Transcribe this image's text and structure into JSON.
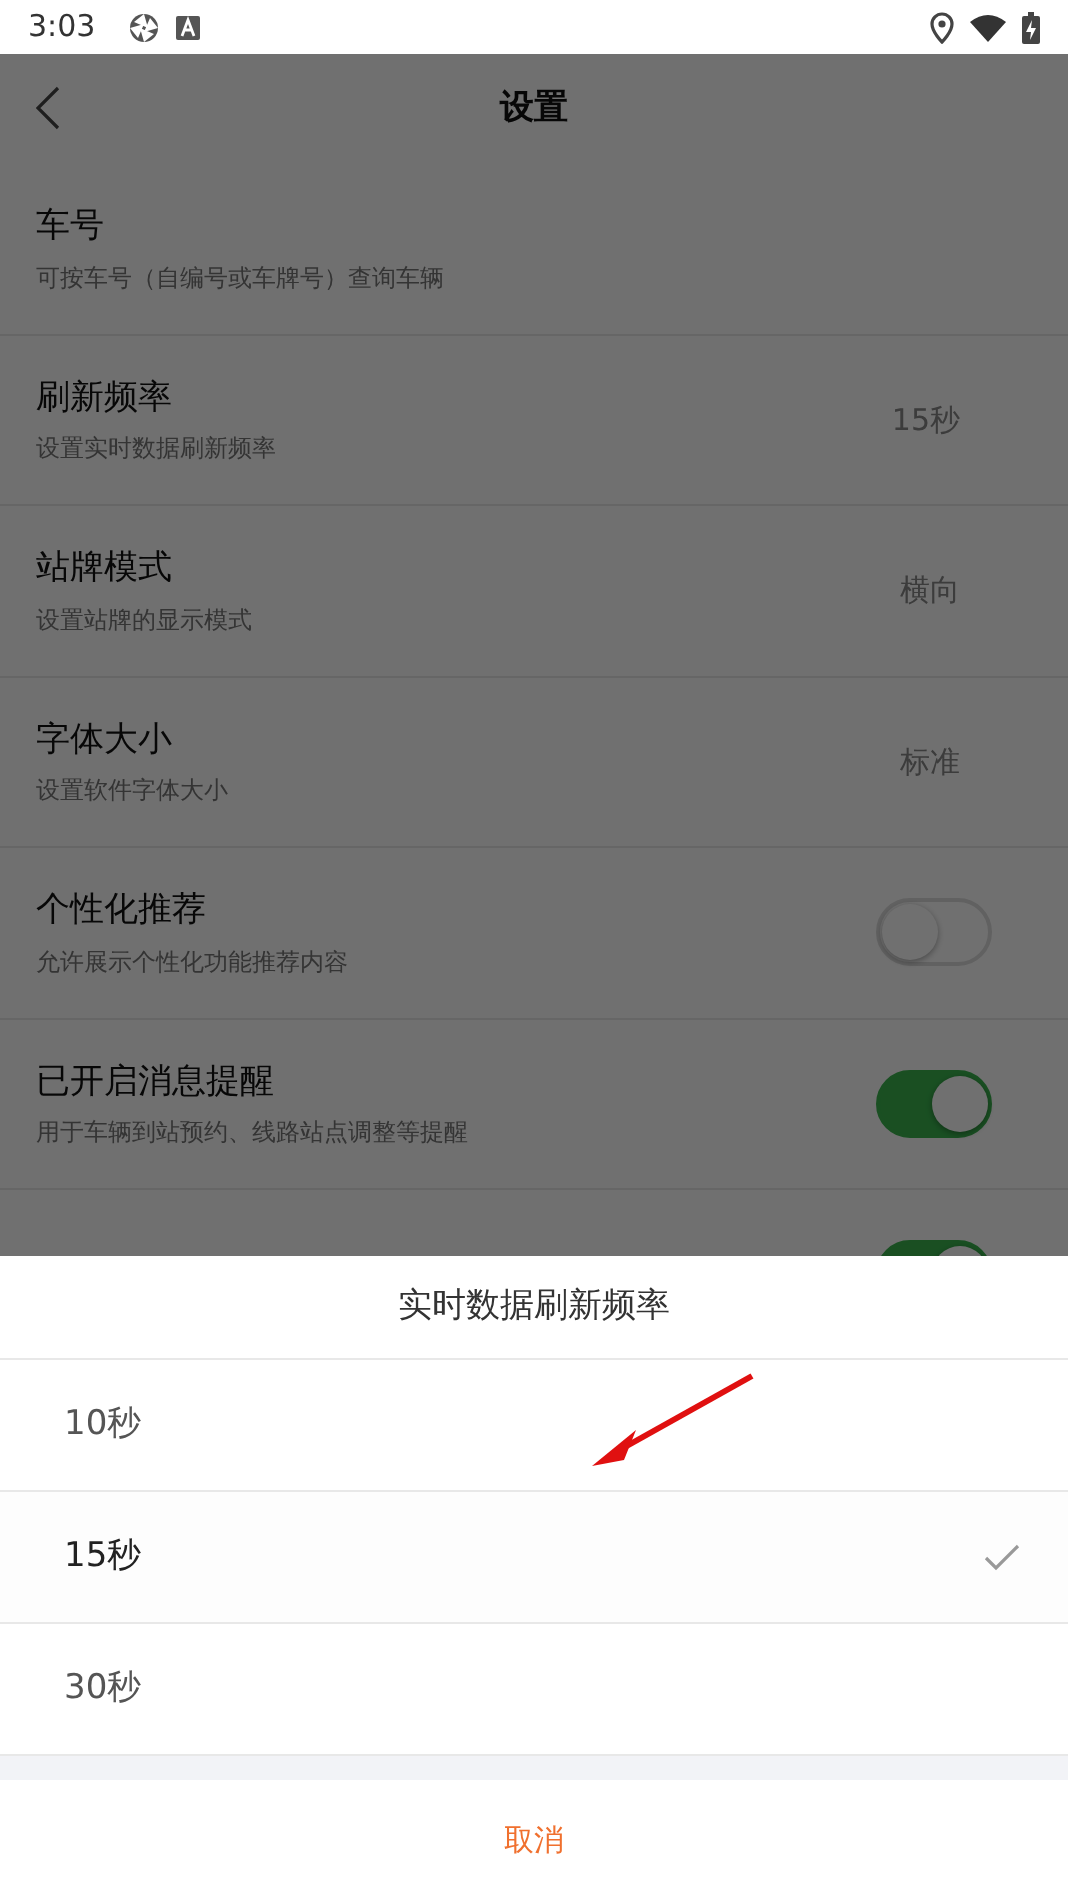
{
  "status_bar": {
    "time": "3:03"
  },
  "header": {
    "title": "设置"
  },
  "settings": [
    {
      "kind": "link",
      "title": "车号",
      "subtitle": "可按车号（自编号或车牌号）查询车辆"
    },
    {
      "kind": "value",
      "title": "刷新频率",
      "subtitle": "设置实时数据刷新频率",
      "value": "15秒"
    },
    {
      "kind": "value",
      "title": "站牌模式",
      "subtitle": "设置站牌的显示模式",
      "value": "横向"
    },
    {
      "kind": "value",
      "title": "字体大小",
      "subtitle": "设置软件字体大小",
      "value": "标准"
    },
    {
      "kind": "toggle",
      "title": "个性化推荐",
      "subtitle": "允许展示个性化功能推荐内容",
      "on": false
    },
    {
      "kind": "toggle",
      "title": "已开启消息提醒",
      "subtitle": "用于车辆到站预约、线路站点调整等提醒",
      "on": true
    },
    {
      "kind": "toggle",
      "on": true
    }
  ],
  "sheet": {
    "title": "实时数据刷新频率",
    "options": [
      {
        "label": "10秒",
        "selected": false
      },
      {
        "label": "15秒",
        "selected": true
      },
      {
        "label": "30秒",
        "selected": false
      }
    ],
    "cancel": "取消"
  }
}
